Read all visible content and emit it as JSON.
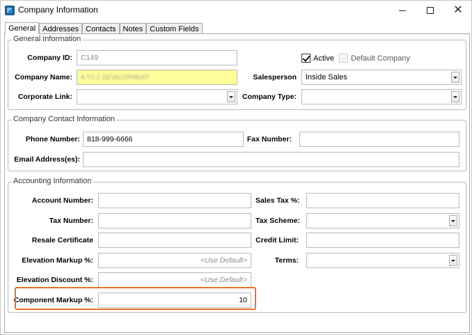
{
  "window": {
    "title": "Company Information",
    "minimize_icon": "minimize-icon",
    "maximize_icon": "maximize-icon",
    "close_icon": "close-icon",
    "close_glyph": "✕"
  },
  "tabs": [
    {
      "label": "General",
      "active": true
    },
    {
      "label": "Addresses",
      "active": false
    },
    {
      "label": "Contacts",
      "active": false
    },
    {
      "label": "Notes",
      "active": false
    },
    {
      "label": "Custom Fields",
      "active": false
    }
  ],
  "general": {
    "legend": "General Information",
    "company_id_label": "Company ID:",
    "company_id_value": "C149",
    "company_name_label": "Company Name:",
    "company_name_value": "A TO Z DEVELOPMENT",
    "corporate_link_label": "Corporate Link:",
    "corporate_link_value": "",
    "active_label": "Active",
    "active_checked": true,
    "default_company_label": "Default Company",
    "default_company_checked": false,
    "salesperson_label": "Salesperson",
    "salesperson_value": "Inside Sales",
    "company_type_label": "Company Type:",
    "company_type_value": ""
  },
  "contact": {
    "legend": "Company Contact Information",
    "phone_label": "Phone Number:",
    "phone_value": "818-999-6666",
    "fax_label": "Fax Number:",
    "fax_value": "",
    "email_label": "Email Address(es):",
    "email_value": ""
  },
  "accounting": {
    "legend": "Accounting Information",
    "account_number_label": "Account Number:",
    "account_number_value": "",
    "tax_number_label": "Tax Number:",
    "tax_number_value": "",
    "resale_certificate_label": "Resale Certificate",
    "resale_certificate_value": "",
    "elevation_markup_label": "Elevation Markup %:",
    "elevation_markup_placeholder": "<Use Default>",
    "elevation_discount_label": "Elevation Discount %:",
    "elevation_discount_placeholder": "<Use Default>",
    "component_markup_label": "Component Markup %:",
    "component_markup_value": "10",
    "sales_tax_label": "Sales Tax %:",
    "sales_tax_value": "",
    "tax_scheme_label": "Tax Scheme:",
    "tax_scheme_value": "",
    "credit_limit_label": "Credit Limit:",
    "credit_limit_value": "",
    "terms_label": "Terms:",
    "terms_value": ""
  },
  "colors": {
    "highlight_field": "#ffff99",
    "callout_border": "#e8702a"
  }
}
